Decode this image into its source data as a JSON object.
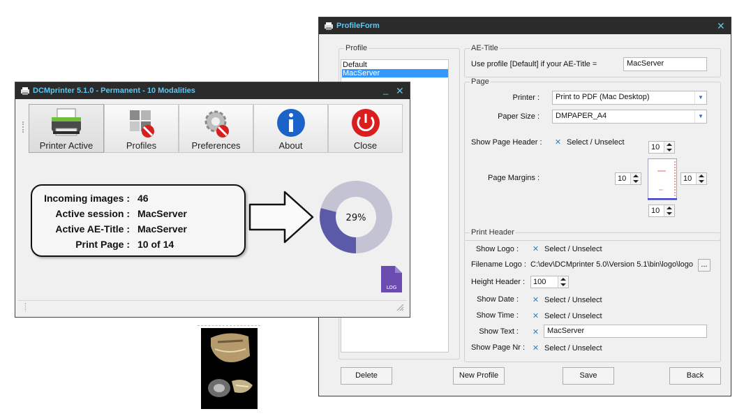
{
  "profile_form": {
    "title": "ProfileForm",
    "profile_group": {
      "legend": "Profile",
      "items": [
        "Default",
        "MacServer"
      ],
      "selected_index": 1
    },
    "ae_title_group": {
      "legend": "AE-Title",
      "label": "Use profile [Default] if your AE-Title =",
      "value": "MacServer"
    },
    "page_group": {
      "legend": "Page",
      "printer_label": "Printer :",
      "printer_value": "Print to PDF (Mac Desktop)",
      "paper_size_label": "Paper Size :",
      "paper_size_value": "DMPAPER_A4",
      "show_page_header_label": "Show Page Header :",
      "show_page_header_check": "Select / Unselect",
      "page_margins_label": "Page Margins :",
      "margin_top": "10",
      "margin_left": "10",
      "margin_right": "10",
      "margin_bottom": "10"
    },
    "print_header_group": {
      "legend": "Print Header",
      "show_logo_label": "Show Logo :",
      "show_logo_check": "Select / Unselect",
      "filename_logo_label": "Filename Logo :",
      "filename_logo_value": "C:\\dev\\DCMprinter 5.0\\Version 5.1\\bin\\logo\\logo",
      "browse_label": "...",
      "height_header_label": "Height Header :",
      "height_header_value": "100",
      "show_date_label": "Show Date :",
      "show_date_check": "Select / Unselect",
      "show_time_label": "Show Time :",
      "show_time_check": "Select / Unselect",
      "show_text_label": "Show Text :",
      "show_text_value": "MacServer",
      "show_page_nr_label": "Show Page Nr :",
      "show_page_nr_check": "Select / Unselect"
    },
    "buttons": {
      "delete": "Delete",
      "new_profile": "New Profile",
      "save": "Save",
      "back": "Back"
    },
    "close_glyph": "✕"
  },
  "dcm_window": {
    "title": "DCMprinter 5.1.0 - Permanent - 10 Modalities",
    "minimize_glyph": "_",
    "close_glyph": "✕",
    "toolbar": [
      {
        "label": "Printer Active",
        "icon": "printer-icon"
      },
      {
        "label": "Profiles",
        "icon": "profiles-disabled-icon"
      },
      {
        "label": "Preferences",
        "icon": "preferences-disabled-icon"
      },
      {
        "label": "About",
        "icon": "info-icon"
      },
      {
        "label": "Close",
        "icon": "power-icon"
      }
    ],
    "info_panel": {
      "incoming_images_label": "Incoming images :",
      "incoming_images_value": "46",
      "active_session_label": "Active session :",
      "active_session_value": "MacServer",
      "active_ae_title_label": "Active AE-Title :",
      "active_ae_title_value": "MacServer",
      "print_page_label": "Print Page :",
      "print_page_value": "10 of 14"
    },
    "progress": {
      "label": "29%",
      "fraction": 0.29,
      "fill_color": "#5b5aa8",
      "track_color": "#c4c3d4"
    },
    "log_label": "LOG",
    "log_color": "#6a4cb0"
  }
}
